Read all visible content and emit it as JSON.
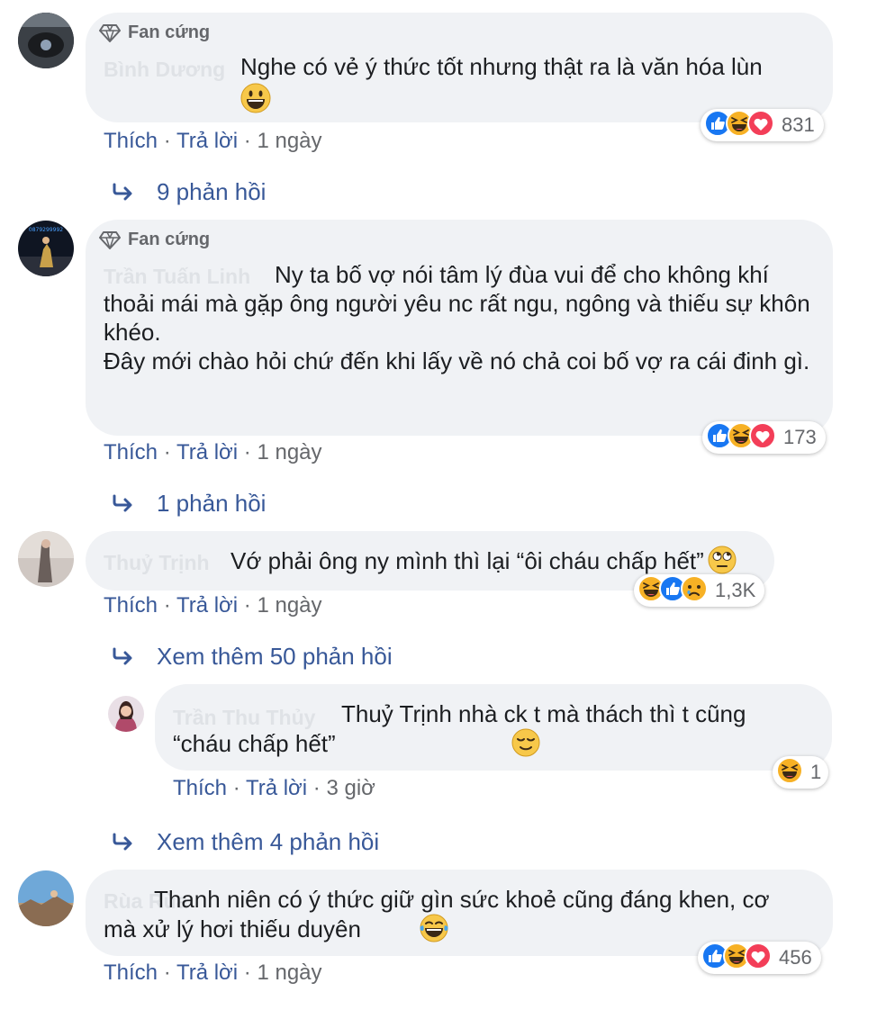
{
  "comments": [
    {
      "badge": "Fan cứng",
      "author": "Bình Dương",
      "text": "Nghe có vẻ ý thức tốt nhưng thật ra là văn hóa lùn",
      "actions": {
        "like": "Thích",
        "sep1": " · ",
        "reply": "Trả lời",
        "sep2": " · ",
        "time": "1 ngày"
      },
      "reaction_count": "831",
      "replies_link": "9 phản hồi"
    },
    {
      "badge": "Fan cứng",
      "author": "Trần Tuấn Linh",
      "text": "Ny ta bố vợ nói tâm lý đùa vui để cho không khí thoải mái mà gặp ông người yêu nc rất ngu, ngông và thiếu sự khôn khéo.",
      "text2": "Đây mới chào hỏi chứ đến khi lấy về nó chả coi bố vợ ra cái đinh gì.",
      "actions": {
        "like": "Thích",
        "sep1": " · ",
        "reply": "Trả lời",
        "sep2": " · ",
        "time": "1 ngày"
      },
      "reaction_count": "173",
      "replies_link": "1 phản hồi",
      "avatar_text": "0879299992"
    },
    {
      "author": "Thuỷ Trịnh",
      "text": "Vớ phải ông ny mình thì lại “ôi cháu chấp hết”",
      "actions": {
        "like": "Thích",
        "sep1": " · ",
        "reply": "Trả lời",
        "sep2": " · ",
        "time": "1 ngày"
      },
      "reaction_count": "1,3K",
      "replies_link": "Xem thêm 50 phản hồi"
    },
    {
      "author": "Rùa Rùa",
      "text": "Thanh niên có ý thức giữ gìn sức khoẻ cũng đáng khen, cơ mà xử lý hơi thiếu duyên",
      "actions": {
        "like": "Thích",
        "sep1": " · ",
        "reply": "Trả lời",
        "sep2": " · ",
        "time": "1 ngày"
      },
      "reaction_count": "456"
    }
  ],
  "reply": {
    "author": "Trần Thu Thủy",
    "text": "Thuỷ Trịnh nhà ck t mà thách thì t cũng “cháu chấp hết”",
    "actions": {
      "like": "Thích",
      "sep1": " · ",
      "reply": "Trả lời",
      "sep2": " · ",
      "time": "3 giờ"
    },
    "reaction_count": "1",
    "more_link": "Xem thêm 4 phản hồi"
  },
  "colors": {
    "bubble": "#f0f2f5",
    "link": "#385898",
    "meta": "#65676b",
    "like": "#1877f2",
    "love": "#f33e58",
    "haha": "#f7b125"
  },
  "icons": [
    "diamond-icon",
    "reply-arrow-icon",
    "like-reaction-icon",
    "haha-reaction-icon",
    "love-reaction-icon",
    "sad-reaction-icon",
    "grin-emoji-icon",
    "rolling-eyes-emoji-icon",
    "relieved-emoji-icon",
    "laughing-emoji-icon"
  ]
}
